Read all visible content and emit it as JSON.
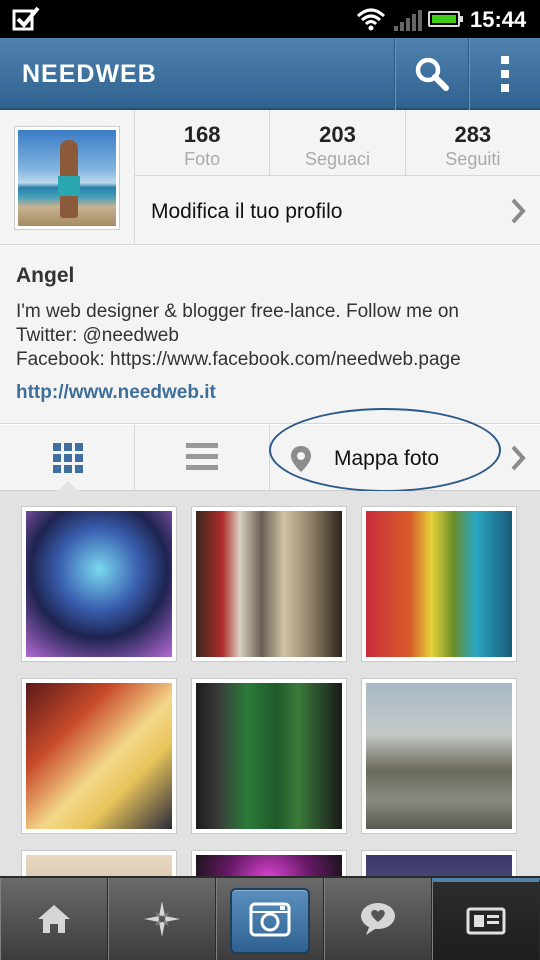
{
  "status_bar": {
    "time": "15:44",
    "icons": [
      "checkbox-icon",
      "wifi-icon",
      "signal-icon",
      "battery-icon"
    ]
  },
  "action_bar": {
    "title": "NEEDWEB",
    "icons": [
      "search-icon",
      "overflow-menu-icon"
    ]
  },
  "profile": {
    "stats": [
      {
        "value": "168",
        "label": "Foto"
      },
      {
        "value": "203",
        "label": "Seguaci"
      },
      {
        "value": "283",
        "label": "Seguiti"
      }
    ],
    "edit_label": "Modifica il tuo profilo"
  },
  "bio": {
    "name": "Angel",
    "lines": [
      "I'm web designer & blogger free-lance. Follow me on",
      "Twitter: @needweb",
      "Facebook: https://www.facebook.com/needweb.page"
    ],
    "website": "http://www.needweb.it"
  },
  "tabs": {
    "grid_icon": "grid-view-icon",
    "list_icon": "list-view-icon",
    "map_label": "Mappa foto"
  },
  "bottom_nav": {
    "items": [
      "home-icon",
      "explore-icon",
      "camera-icon",
      "news-icon",
      "profile-icon"
    ]
  },
  "colors": {
    "action_bar": "#3f73a0",
    "link": "#3d6f9a",
    "annotation": "#2c5a8a"
  }
}
